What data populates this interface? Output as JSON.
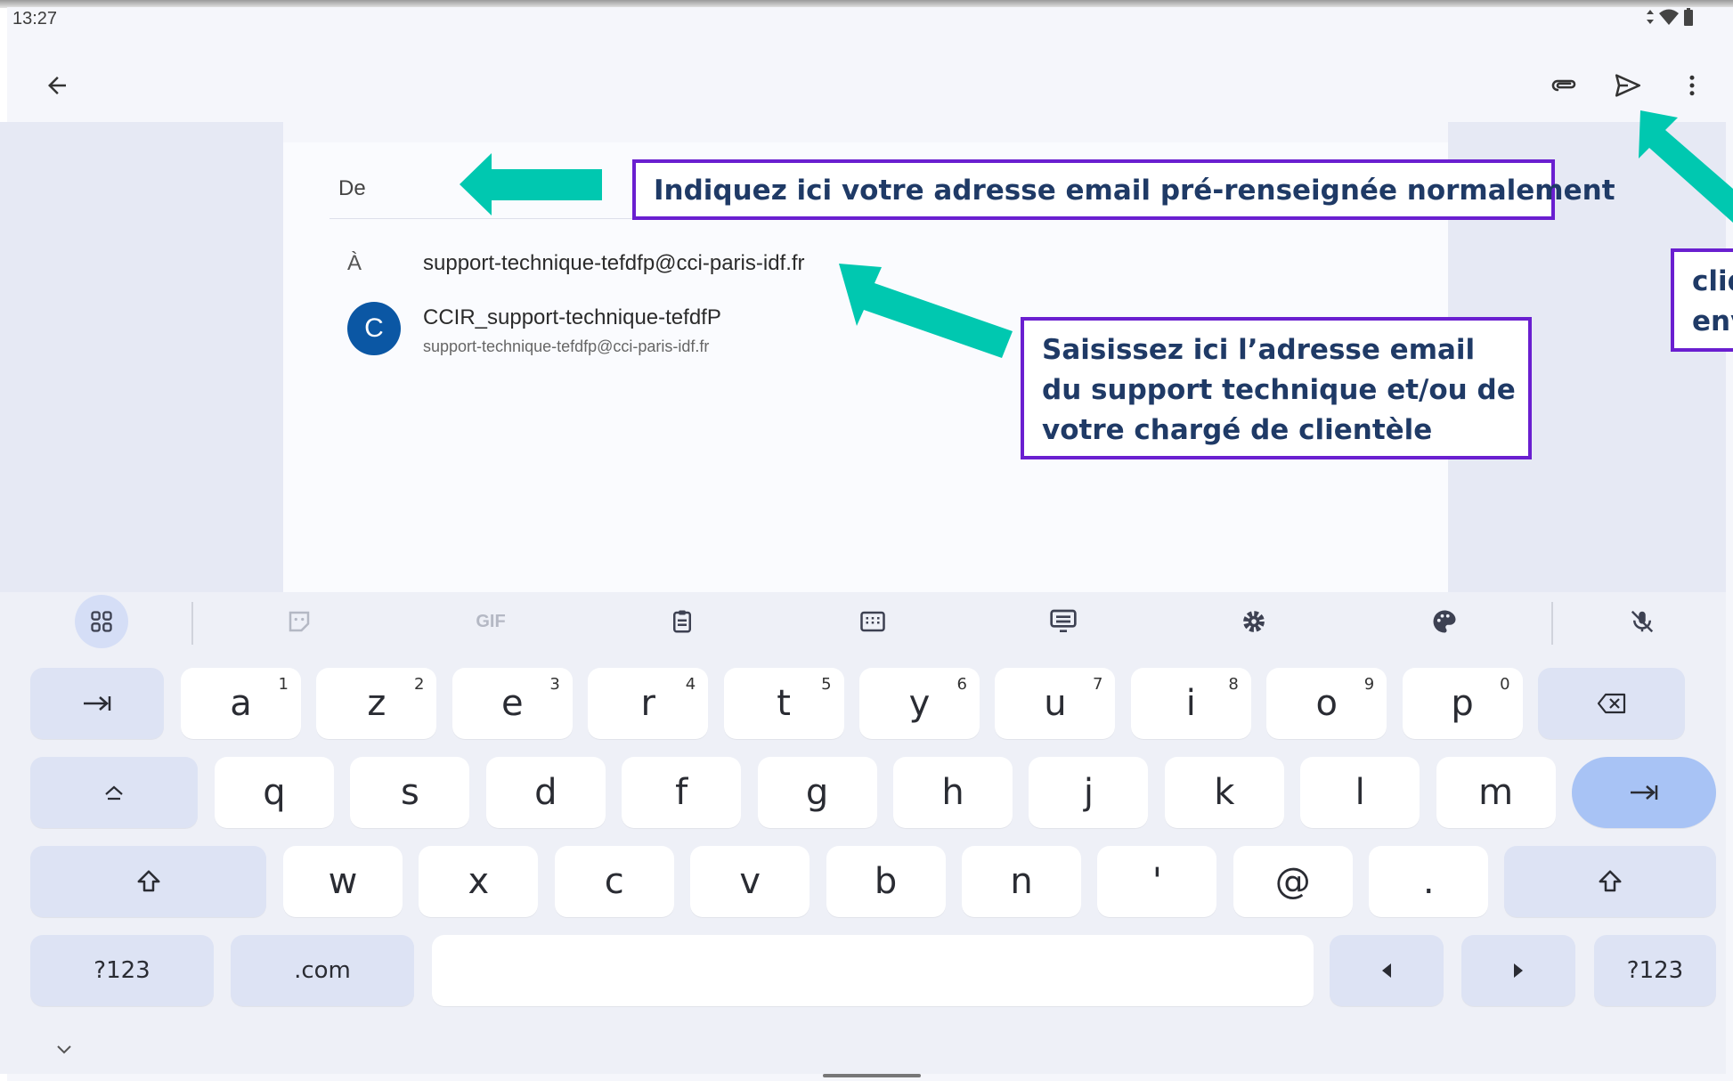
{
  "status": {
    "time": "13:27"
  },
  "compose": {
    "from_label": "De",
    "to_label": "À",
    "to_value": "support-technique-tefdfp@cci-paris-idf.fr",
    "suggestion": {
      "initial": "C",
      "name": "CCIR_support-technique-tefdfP",
      "email": "support-technique-tefdfp@cci-paris-idf.fr"
    }
  },
  "annotations": {
    "from": "Indiquez ici votre adresse email pré-renseignée normalement",
    "to": [
      "Saisissez ici l’adresse email",
      "du support technique et/ou de",
      "votre chargé de clientèle"
    ],
    "send": [
      "cliq",
      "env"
    ],
    "arrow_color": "#00c8b0",
    "border_color": "#6a1fd0"
  },
  "keyboard": {
    "toolbar": {
      "gif": "GIF"
    },
    "row1": [
      {
        "k": "a",
        "s": "1"
      },
      {
        "k": "z",
        "s": "2"
      },
      {
        "k": "e",
        "s": "3"
      },
      {
        "k": "r",
        "s": "4"
      },
      {
        "k": "t",
        "s": "5"
      },
      {
        "k": "y",
        "s": "6"
      },
      {
        "k": "u",
        "s": "7"
      },
      {
        "k": "i",
        "s": "8"
      },
      {
        "k": "o",
        "s": "9"
      },
      {
        "k": "p",
        "s": "0"
      }
    ],
    "row2": [
      "q",
      "s",
      "d",
      "f",
      "g",
      "h",
      "j",
      "k",
      "l",
      "m"
    ],
    "row3": [
      "w",
      "x",
      "c",
      "v",
      "b",
      "n",
      "'",
      "@",
      "."
    ],
    "row4": {
      "sym_left": "?123",
      "dotcom": ".com",
      "sym_right": "?123"
    }
  }
}
